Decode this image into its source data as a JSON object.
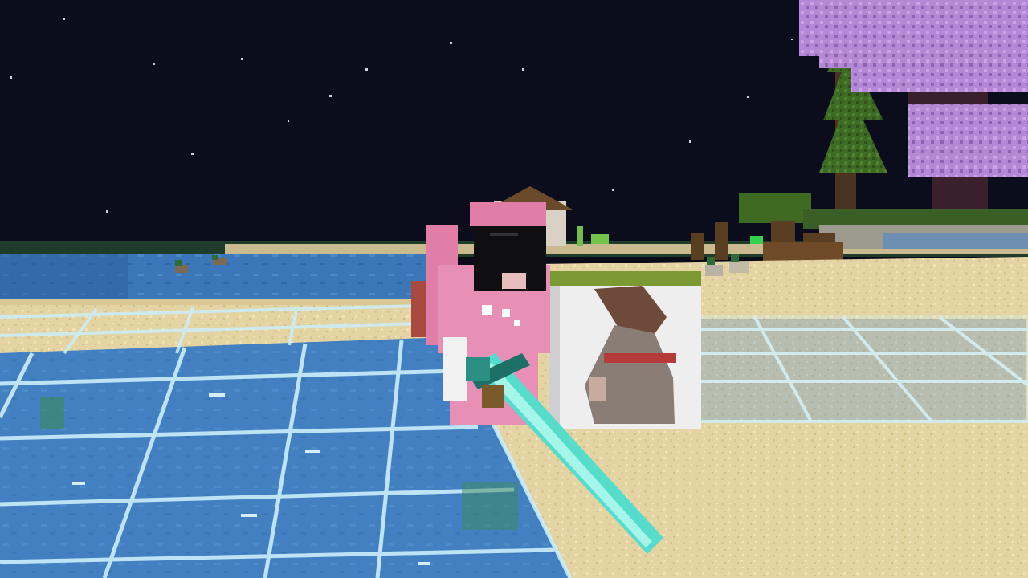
{
  "scene": {
    "sky_color": "#0b0d1d",
    "water_color": "#2f6fb8",
    "sand_color": "#e6d7a8",
    "glass_edge_color": "#bfeaf7",
    "cherry_leaf_color": "#b88ad6",
    "spruce_color": "#3f6a22",
    "player_skin_color": "#e88fb6",
    "sword_color": "#4fd9c7"
  },
  "entities": {
    "player": "player-character",
    "held_item": "diamond-sword-icon",
    "painting": "painting-figure",
    "mobs": [
      "duck",
      "duck",
      "duck",
      "duck"
    ]
  },
  "hud": {}
}
